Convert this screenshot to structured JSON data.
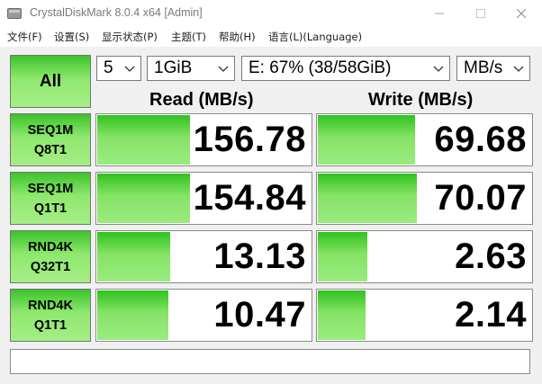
{
  "window": {
    "title": "CrystalDiskMark 8.0.4 x64 [Admin]"
  },
  "menu": {
    "items": [
      {
        "label": "文件(F)"
      },
      {
        "label": "设置(S)"
      },
      {
        "label": "显示状态(P)"
      },
      {
        "label": "主题(T)"
      },
      {
        "label": "帮助(H)"
      },
      {
        "label": "语言(L)(Language)"
      }
    ]
  },
  "controls": {
    "all_label": "All",
    "test_count": "5",
    "test_size": "1GiB",
    "drive": "E: 67% (38/58GiB)",
    "unit": "MB/s"
  },
  "headers": {
    "read": "Read (MB/s)",
    "write": "Write (MB/s)"
  },
  "tests": [
    {
      "line1": "SEQ1M",
      "line2": "Q8T1",
      "read": "156.78",
      "write": "69.68",
      "read_fill_pct": 43,
      "write_fill_pct": 45
    },
    {
      "line1": "SEQ1M",
      "line2": "Q1T1",
      "read": "154.84",
      "write": "70.07",
      "read_fill_pct": 43,
      "write_fill_pct": 46
    },
    {
      "line1": "RND4K",
      "line2": "Q32T1",
      "read": "13.13",
      "write": "2.63",
      "read_fill_pct": 34,
      "write_fill_pct": 23
    },
    {
      "line1": "RND4K",
      "line2": "Q1T1",
      "read": "10.47",
      "write": "2.14",
      "read_fill_pct": 33,
      "write_fill_pct": 22
    }
  ],
  "comment": "",
  "colors": {
    "bar_green": "#86e366",
    "button_green": "#8fe86e"
  },
  "icons": {
    "app": "disk-icon",
    "minimize": "minimize-icon",
    "maximize": "maximize-icon",
    "close": "close-icon",
    "dropdown": "chevron-down-icon"
  }
}
